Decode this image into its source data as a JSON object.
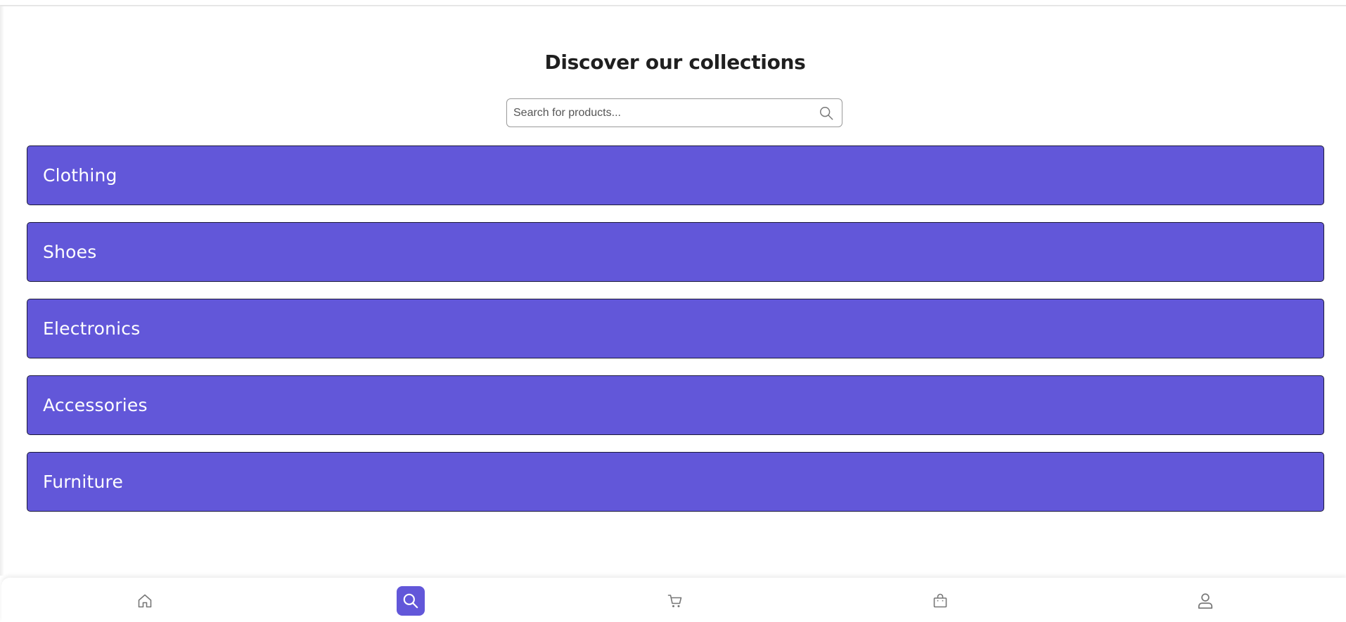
{
  "header": {
    "title": "Discover our collections"
  },
  "search": {
    "placeholder": "Search for products...",
    "value": "",
    "icon": "search-icon"
  },
  "categories": [
    {
      "label": "Clothing"
    },
    {
      "label": "Shoes"
    },
    {
      "label": "Electronics"
    },
    {
      "label": "Accessories"
    },
    {
      "label": "Furniture"
    }
  ],
  "bottom_nav": {
    "items": [
      {
        "icon": "home-icon",
        "active": false
      },
      {
        "icon": "search-icon",
        "active": true
      },
      {
        "icon": "cart-icon",
        "active": false
      },
      {
        "icon": "shopping-bag-icon",
        "active": false
      },
      {
        "icon": "user-icon",
        "active": false
      }
    ]
  },
  "colors": {
    "accent": "#6257d9",
    "icon_inactive": "#777777",
    "icon_active": "#ffffff"
  }
}
